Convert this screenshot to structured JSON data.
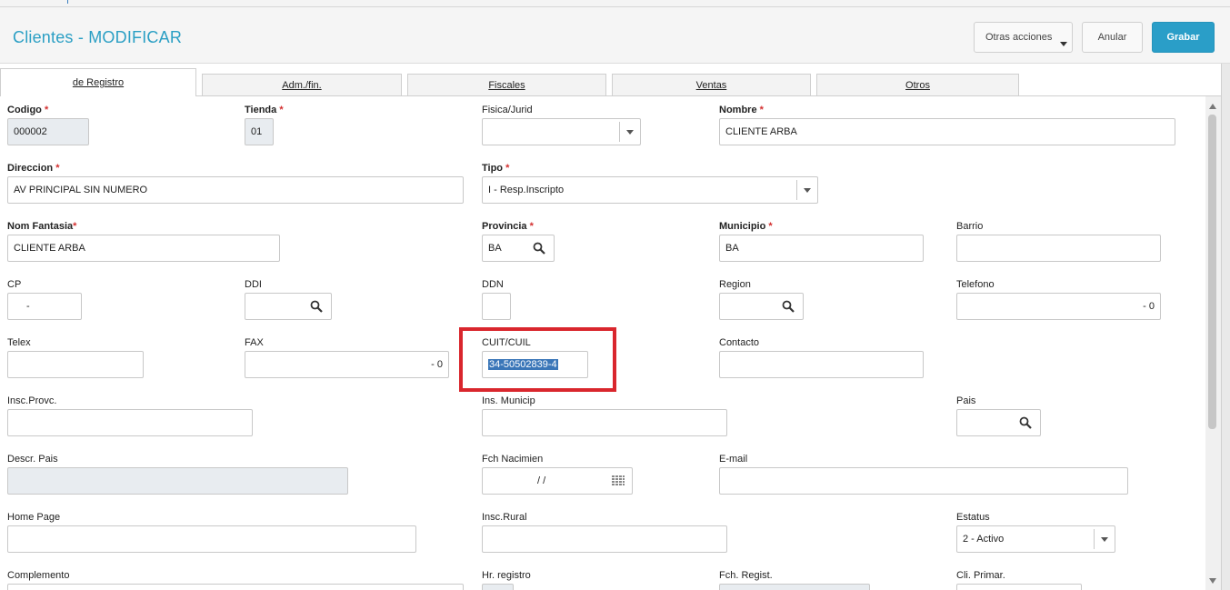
{
  "header": {
    "title": "Clientes - MODIFICAR",
    "otras_acciones": "Otras acciones",
    "anular": "Anular",
    "grabar": "Grabar"
  },
  "tabs": [
    {
      "label": "de Registro",
      "active": true
    },
    {
      "label": "Adm./fin.",
      "active": false
    },
    {
      "label": "Fiscales",
      "active": false
    },
    {
      "label": "Ventas",
      "active": false
    },
    {
      "label": "Otros",
      "active": false
    }
  ],
  "fields": {
    "codigo": {
      "label": "Codigo",
      "value": "000002"
    },
    "tienda": {
      "label": "Tienda",
      "value": "01"
    },
    "fisica_jurid": {
      "label": "Fisica/Jurid",
      "value": ""
    },
    "nombre": {
      "label": "Nombre",
      "value": "CLIENTE ARBA"
    },
    "direccion": {
      "label": "Direccion",
      "value": "AV PRINCIPAL SIN NUMERO"
    },
    "tipo": {
      "label": "Tipo",
      "value": "I - Resp.Inscripto"
    },
    "nom_fantasia": {
      "label": "Nom Fantasia",
      "value": "CLIENTE ARBA"
    },
    "provincia": {
      "label": "Provincia",
      "value": "BA"
    },
    "municipio": {
      "label": "Municipio",
      "value": "BA"
    },
    "barrio": {
      "label": "Barrio",
      "value": ""
    },
    "cp": {
      "label": "CP",
      "value": "-"
    },
    "ddi": {
      "label": "DDI",
      "value": ""
    },
    "ddn": {
      "label": "DDN",
      "value": ""
    },
    "region": {
      "label": "Region",
      "value": ""
    },
    "telefono": {
      "label": "Telefono",
      "value": "-  0"
    },
    "telex": {
      "label": "Telex",
      "value": ""
    },
    "fax": {
      "label": "FAX",
      "value": "-  0"
    },
    "cuit_cuil": {
      "label": "CUIT/CUIL",
      "value": "34-50502839-4"
    },
    "contacto": {
      "label": "Contacto",
      "value": ""
    },
    "insc_provc": {
      "label": "Insc.Provc.",
      "value": ""
    },
    "ins_municip": {
      "label": "Ins. Municip",
      "value": ""
    },
    "pais": {
      "label": "Pais",
      "value": ""
    },
    "descr_pais": {
      "label": "Descr. Pais",
      "value": ""
    },
    "fch_nacimien": {
      "label": "Fch Nacimien",
      "value": "/ /"
    },
    "email": {
      "label": "E-mail",
      "value": ""
    },
    "home_page": {
      "label": "Home Page",
      "value": ""
    },
    "insc_rural": {
      "label": "Insc.Rural",
      "value": ""
    },
    "estatus": {
      "label": "Estatus",
      "value": "2 - Activo"
    },
    "complemento": {
      "label": "Complemento",
      "value": ""
    },
    "hr_registro": {
      "label": "Hr. registro",
      "value": ""
    },
    "fch_regist": {
      "label": "Fch. Regist.",
      "value": ""
    },
    "cli_primar": {
      "label": "Cli. Primar.",
      "value": ""
    }
  },
  "required_mark": "*",
  "colors": {
    "accent": "#2a9ec8",
    "highlight": "#d9262d",
    "required": "#d32f2f"
  },
  "icons": {
    "search": "magnifier-icon",
    "calendar": "calendar-icon",
    "dropdown": "chevron-down-icon"
  }
}
